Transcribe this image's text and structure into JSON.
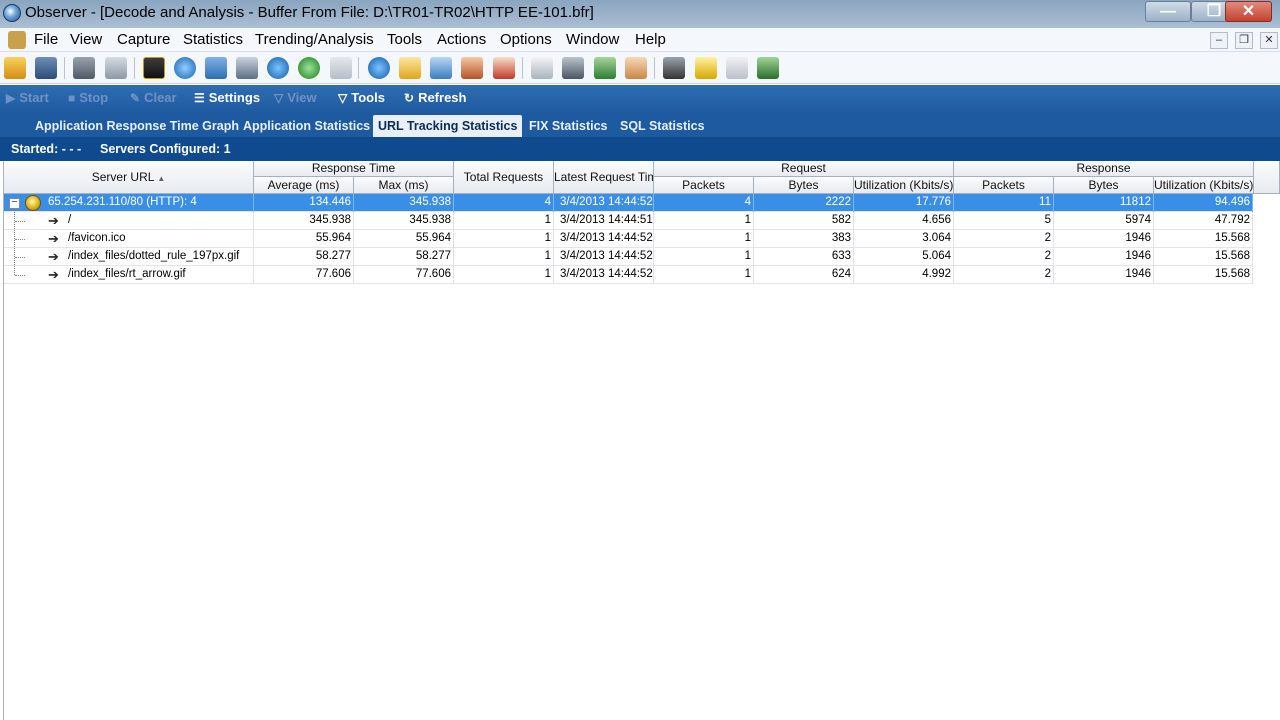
{
  "window": {
    "title": "Observer - [Decode and Analysis - Buffer From File:  D:\\TR01-TR02\\HTTP EE-101.bfr]",
    "controls": {
      "minimize": "—",
      "maximize": "❐",
      "close": "✕"
    }
  },
  "menu": [
    "File",
    "View",
    "Capture",
    "Statistics",
    "Trending/Analysis",
    "Tools",
    "Actions",
    "Options",
    "Window",
    "Help"
  ],
  "mdi_controls": {
    "minimize": "–",
    "restore": "❐",
    "close": "✕"
  },
  "toolbar_icons": [
    "open-folder-icon",
    "save-icon",
    "camera-icon",
    "download-icon",
    "chart-icon",
    "globe-icon",
    "network-icon",
    "calendar-icon",
    "sigma-icon",
    "pause-circle-icon",
    "plugin-icon",
    "dollar-circle-icon",
    "trend-icon",
    "edit-chart-icon",
    "tools-icon",
    "document-icon",
    "book-icon",
    "printer-icon",
    "tree-icon",
    "foot-icon",
    "runner-icon",
    "filter-icon",
    "trash-icon",
    "monitor-icon"
  ],
  "commands": {
    "start": "Start",
    "stop": "Stop",
    "clear": "Clear",
    "settings": "Settings",
    "view": "View",
    "tools": "Tools",
    "refresh": "Refresh"
  },
  "tabs": [
    "Application Response Time Graph",
    "Application Statistics",
    "URL Tracking Statistics",
    "FIX Statistics",
    "SQL Statistics"
  ],
  "active_tab": "URL Tracking Statistics",
  "status": {
    "started": "Started:  - - -",
    "servers_configured": "Servers Configured: 1"
  },
  "columns": {
    "server_url": "Server URL",
    "sort_indicator": "▲",
    "response_time": "Response Time",
    "average": "Average (ms)",
    "max": "Max (ms)",
    "total_requests": "Total Requests",
    "latest_request_time": "Latest Request Time",
    "request": "Request",
    "response": "Response",
    "packets": "Packets",
    "bytes": "Bytes",
    "utilization": "Utilization (Kbits/s)"
  },
  "rows": [
    {
      "url": "65.254.231.110/80 (HTTP): 4",
      "avg": "134.446",
      "max": "345.938",
      "total": "4",
      "latest": "3/4/2013 14:44:52",
      "req_packets": "4",
      "req_bytes": "2222",
      "req_util": "17.776",
      "resp_packets": "11",
      "resp_bytes": "11812",
      "resp_util": "94.496"
    },
    {
      "url": "/",
      "avg": "345.938",
      "max": "345.938",
      "total": "1",
      "latest": "3/4/2013 14:44:51",
      "req_packets": "1",
      "req_bytes": "582",
      "req_util": "4.656",
      "resp_packets": "5",
      "resp_bytes": "5974",
      "resp_util": "47.792"
    },
    {
      "url": "/favicon.ico",
      "avg": "55.964",
      "max": "55.964",
      "total": "1",
      "latest": "3/4/2013 14:44:52",
      "req_packets": "1",
      "req_bytes": "383",
      "req_util": "3.064",
      "resp_packets": "2",
      "resp_bytes": "1946",
      "resp_util": "15.568"
    },
    {
      "url": "/index_files/dotted_rule_197px.gif",
      "avg": "58.277",
      "max": "58.277",
      "total": "1",
      "latest": "3/4/2013 14:44:52",
      "req_packets": "1",
      "req_bytes": "633",
      "req_util": "5.064",
      "resp_packets": "2",
      "resp_bytes": "1946",
      "resp_util": "15.568"
    },
    {
      "url": "/index_files/rt_arrow.gif",
      "avg": "77.606",
      "max": "77.606",
      "total": "1",
      "latest": "3/4/2013 14:44:52",
      "req_packets": "1",
      "req_bytes": "624",
      "req_util": "4.992",
      "resp_packets": "2",
      "resp_bytes": "1946",
      "resp_util": "15.568"
    }
  ],
  "tree_expander": "−"
}
